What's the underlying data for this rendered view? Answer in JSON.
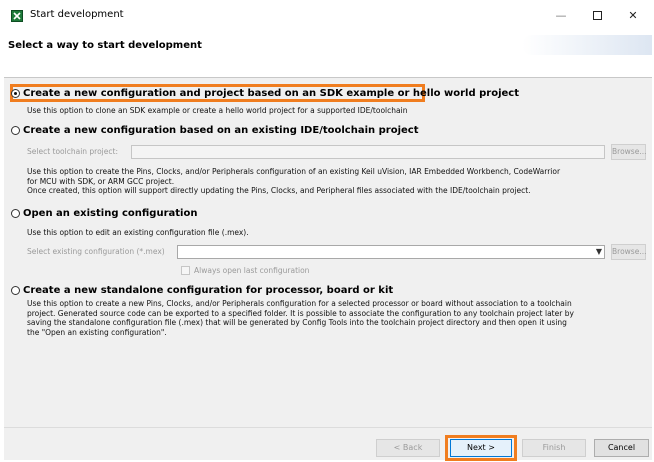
{
  "window": {
    "title": "Start development",
    "minimize_glyph": "—",
    "close_glyph": "✕",
    "icon_name": "app-logo-icon",
    "accent": "#f07d1f"
  },
  "header": {
    "title": "Select a way to start development"
  },
  "options": [
    {
      "label": "Create a new configuration and project based on an SDK example or hello world project",
      "selected": true,
      "description": "Use this option to clone an SDK example or create a hello world project for a supported IDE/toolchain"
    },
    {
      "label": "Create a new configuration based on an existing IDE/toolchain project",
      "selected": false,
      "field_label": "Select toolchain project:",
      "browse_label": "Browse...",
      "description_lines": [
        "Use this option to create the Pins, Clocks, and/or Peripherals configuration of an existing Keil uVision, IAR Embedded Workbench, CodeWarrior",
        "for MCU with SDK, or ARM GCC project.",
        "Once created, this option will support directly updating the Pins, Clocks, and Peripheral files associated with the IDE/toolchain project."
      ]
    },
    {
      "label": "Open an existing configuration",
      "selected": false,
      "description": "Use this option to edit an existing configuration file (.mex).",
      "field_label": "Select existing configuration (*.mex)",
      "browse_label": "Browse...",
      "checkbox_label": "Always open last configuration",
      "checkbox_checked": false
    },
    {
      "label": "Create a new standalone configuration for processor, board or kit",
      "selected": false,
      "description_lines": [
        "Use this option to create a new Pins, Clocks, and/or Peripherals configuration for a selected processor or board without association to a toolchain",
        "project. Generated source code can be exported to a specified folder. It is possible to associate the configuration to any toolchain project later by",
        "saving the standalone configuration file (.mex) that will be generated by Config Tools into the toolchain project directory and then open it using",
        "the \"Open an existing configuration\"."
      ]
    }
  ],
  "footer": {
    "back_label": "< Back",
    "next_label": "Next >",
    "finish_label": "Finish",
    "cancel_label": "Cancel"
  }
}
